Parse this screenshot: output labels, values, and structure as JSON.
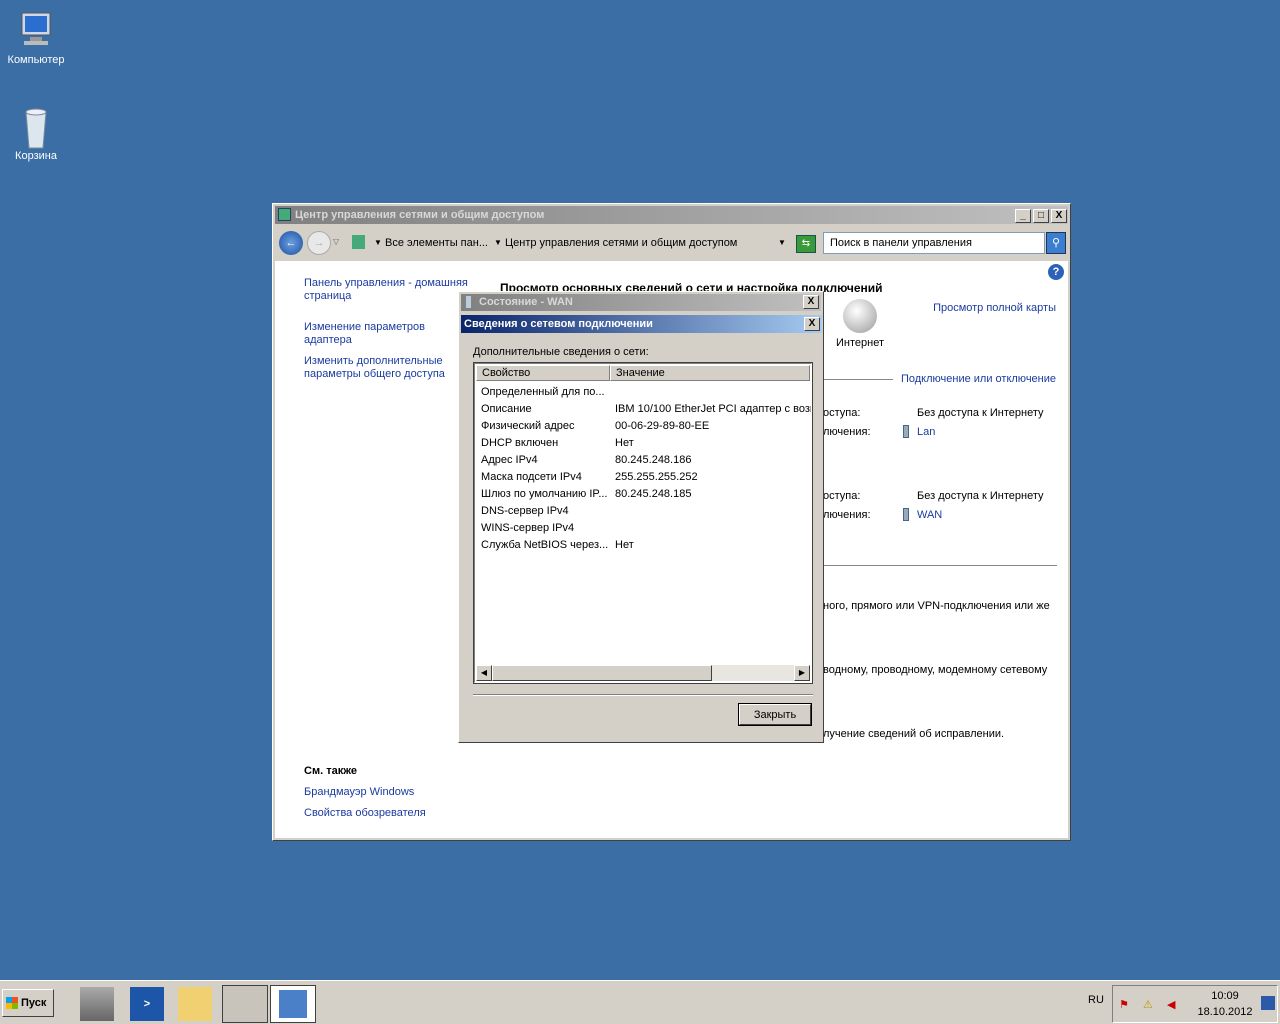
{
  "desktop": {
    "icons": [
      {
        "label": "Компьютер"
      },
      {
        "label": "Корзина"
      }
    ]
  },
  "window": {
    "title": "Центр управления сетями и общим доступом",
    "address": {
      "crumb1": "Все элементы пан...",
      "crumb2": "Центр управления сетями и общим доступом"
    },
    "search_placeholder": "Поиск в панели управления",
    "sidebar": {
      "links": [
        "Панель управления - домашняя страница",
        "Изменение параметров адаптера",
        "Изменить дополнительные параметры общего доступа"
      ],
      "see_also_title": "См. также",
      "see_also": [
        "Брандмауэр Windows",
        "Свойства обозревателя"
      ]
    },
    "main": {
      "heading": "Просмотр основных сведений о сети и настройка подключений",
      "internet_label": "Интернет",
      "full_map_link": "Просмотр полной карты",
      "connect_link": "Подключение или отключение",
      "networks": [
        {
          "access_label": "оступа:",
          "access": "Без доступа к Интернету",
          "conn_label": "лючения:",
          "conn": "Lan"
        },
        {
          "access_label": "оступа:",
          "access": "Без доступа к Интернету",
          "conn_label": "лючения:",
          "conn": "WAN"
        }
      ],
      "tasks": [
        "ного, прямого или VPN-подключения или же",
        "водному, проводному, модемному сетевому",
        "лучение сведений об исправлении."
      ]
    }
  },
  "status_dialog": {
    "title": "Состояние - WAN"
  },
  "details_dialog": {
    "title": "Сведения о сетевом подключении",
    "label": "Дополнительные сведения о сети:",
    "columns": [
      "Свойство",
      "Значение"
    ],
    "rows": [
      [
        "Определенный для по...",
        ""
      ],
      [
        "Описание",
        "IBM 10/100 EtherJet PCI адаптер с возм"
      ],
      [
        "Физический адрес",
        "00-06-29-89-80-EE"
      ],
      [
        "DHCP включен",
        "Нет"
      ],
      [
        "Адрес IPv4",
        "80.245.248.186"
      ],
      [
        "Маска подсети IPv4",
        "255.255.255.252"
      ],
      [
        "Шлюз по умолчанию IP...",
        "80.245.248.185"
      ],
      [
        "DNS-сервер IPv4",
        ""
      ],
      [
        "WINS-сервер IPv4",
        ""
      ],
      [
        "Служба NetBIOS через...",
        "Нет"
      ]
    ],
    "close_label": "Закрыть"
  },
  "taskbar": {
    "start_label": "Пуск",
    "lang": "RU",
    "time": "10:09",
    "date": "18.10.2012"
  }
}
